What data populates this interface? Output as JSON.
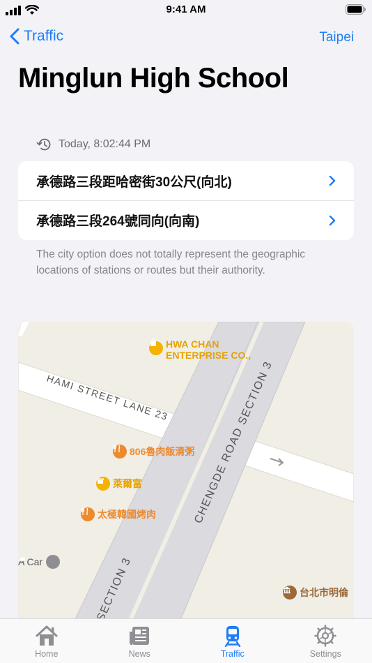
{
  "status_bar": {
    "time": "9:41 AM"
  },
  "nav": {
    "back_label": "Traffic",
    "city_label": "Taipei"
  },
  "page": {
    "title": "Minglun High School"
  },
  "timestamp": {
    "text": "Today, 8:02:44 PM",
    "icon": "clock-history-icon"
  },
  "stops": [
    {
      "label": "承德路三段距哈密街30公尺(向北)"
    },
    {
      "label": "承德路三段264號同向(向南)"
    }
  ],
  "footnote": "The city option does not totally represent the geographic locations of stations or routes but their authority.",
  "map": {
    "road_labels": [
      "HAMI STREET LANE 23",
      "CHENGDE ROAD SECTION 3",
      "SECTION 3"
    ],
    "pois": {
      "company_line1": "HWA CHAN",
      "company_line2": "ENTERPRISE CO.,",
      "restaurant1": "806魯肉飯清粥",
      "shop": "萊爾富",
      "restaurant2": "太極韓國烤肉",
      "car": "A Car",
      "school": "台北市明倫"
    }
  },
  "tabs": [
    {
      "label": "Home",
      "icon": "house-icon"
    },
    {
      "label": "News",
      "icon": "newspaper-icon"
    },
    {
      "label": "Traffic",
      "icon": "tram-icon",
      "active": true
    },
    {
      "label": "Settings",
      "icon": "gear-icon"
    }
  ],
  "colors": {
    "accent": "#1E7CF5",
    "background": "#F2F2F7",
    "secondary_text": "#85858A"
  }
}
